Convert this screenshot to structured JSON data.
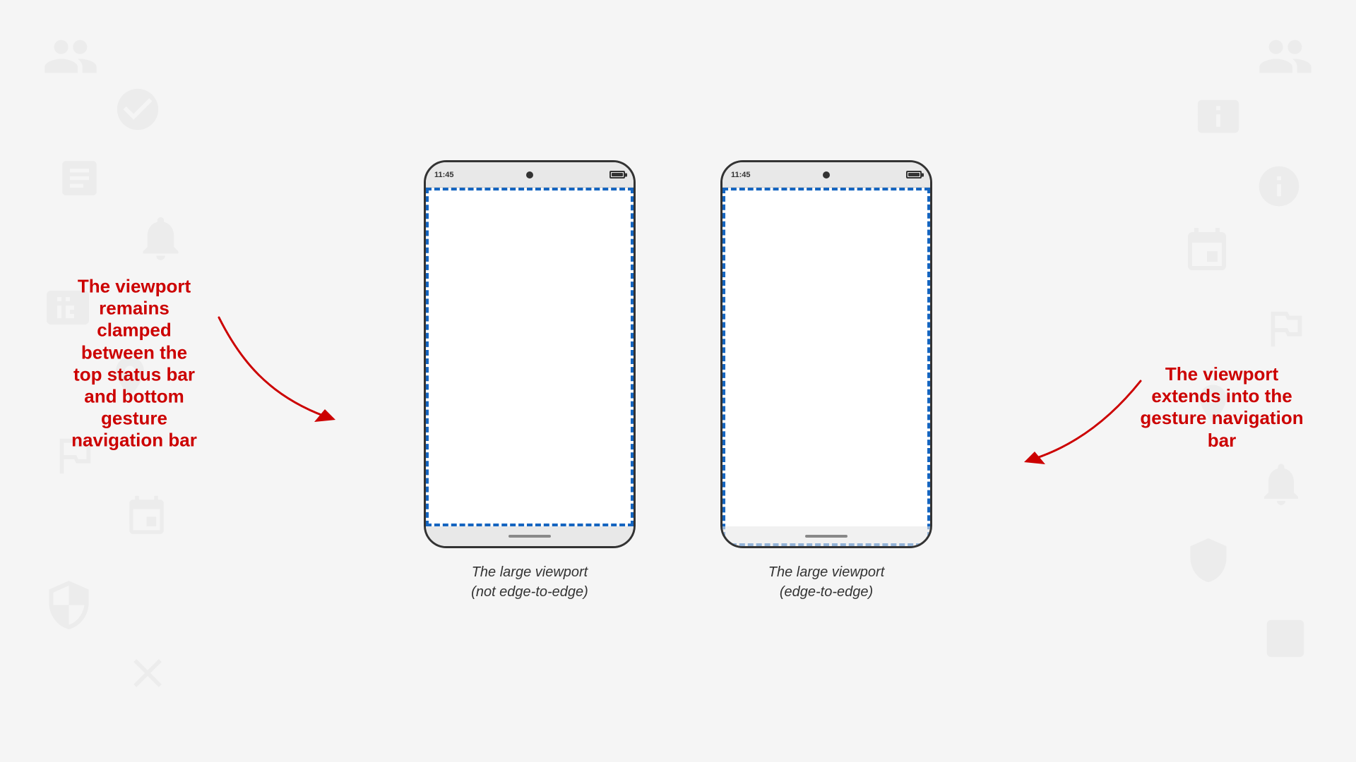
{
  "page": {
    "background_color": "#f5f5f5"
  },
  "left_phone": {
    "status_time": "11:45",
    "caption_line1": "The large viewport",
    "caption_line2": "(not edge-to-edge)",
    "type": "clamped"
  },
  "right_phone": {
    "status_time": "11:45",
    "caption_line1": "The large viewport",
    "caption_line2": "(edge-to-edge)",
    "type": "edge-to-edge"
  },
  "annotation_left": {
    "text": "The viewport remains clamped between the top status bar and bottom gesture navigation bar"
  },
  "annotation_right": {
    "text": "The viewport extends into the gesture navigation bar"
  }
}
